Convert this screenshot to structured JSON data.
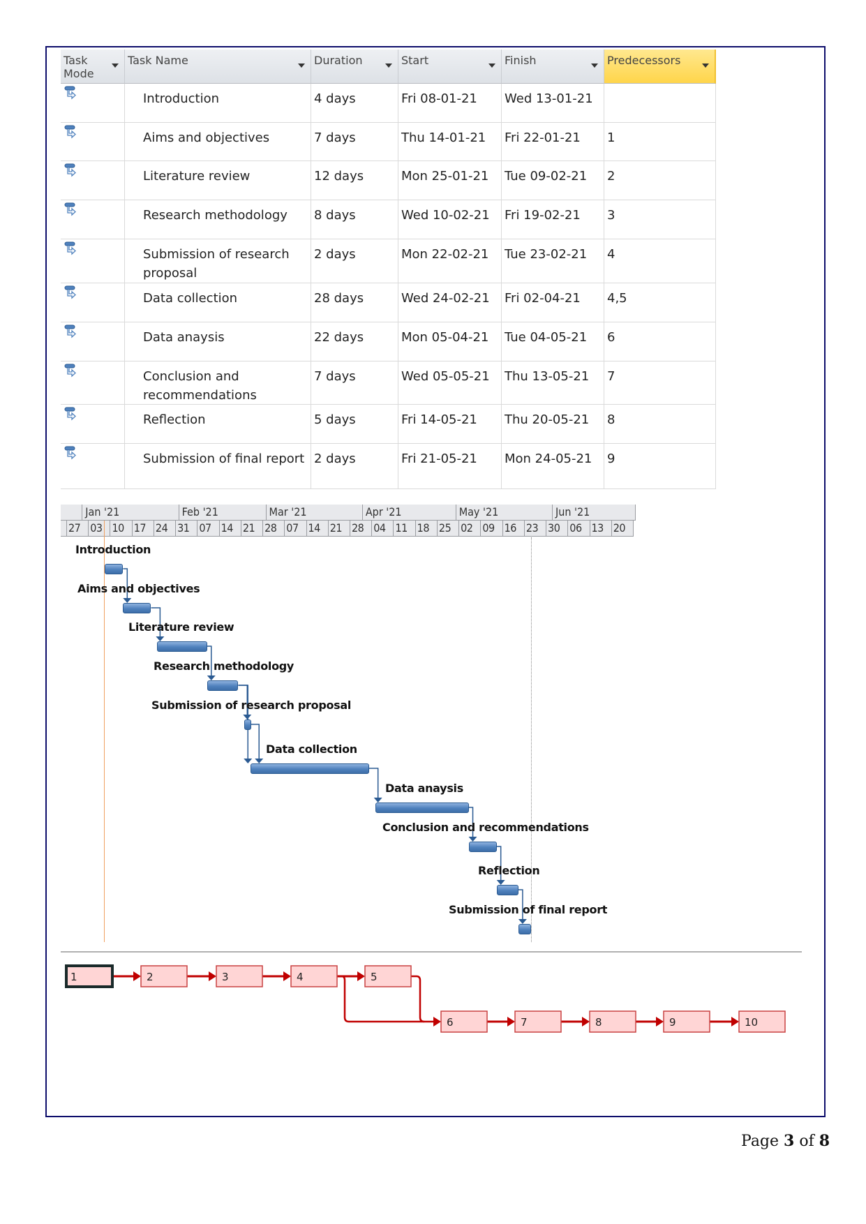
{
  "table": {
    "columns": [
      {
        "label": "Task Mode"
      },
      {
        "label": "Task Name"
      },
      {
        "label": "Duration"
      },
      {
        "label": "Start"
      },
      {
        "label": "Finish"
      },
      {
        "label": "Predecessors"
      }
    ],
    "tasks": [
      {
        "id": 1,
        "mode_icon": "auto-scheduled-task-icon",
        "name": "Introduction",
        "duration": "4 days",
        "start": "Fri 08-01-21",
        "finish": "Wed 13-01-21",
        "predecessors": ""
      },
      {
        "id": 2,
        "mode_icon": "auto-scheduled-task-icon",
        "name": "Aims and objectives",
        "duration": "7 days",
        "start": "Thu 14-01-21",
        "finish": "Fri 22-01-21",
        "predecessors": "1"
      },
      {
        "id": 3,
        "mode_icon": "auto-scheduled-task-icon",
        "name": "Literature review",
        "duration": "12 days",
        "start": "Mon 25-01-21",
        "finish": "Tue 09-02-21",
        "predecessors": "2"
      },
      {
        "id": 4,
        "mode_icon": "auto-scheduled-task-icon",
        "name": "Research methodology",
        "duration": "8 days",
        "start": "Wed 10-02-21",
        "finish": "Fri 19-02-21",
        "predecessors": "3"
      },
      {
        "id": 5,
        "mode_icon": "auto-scheduled-task-icon",
        "name": "Submission of research proposal",
        "duration": "2 days",
        "start": "Mon 22-02-21",
        "finish": "Tue 23-02-21",
        "predecessors": "4"
      },
      {
        "id": 6,
        "mode_icon": "auto-scheduled-task-icon",
        "name": "Data collection",
        "duration": "28 days",
        "start": "Wed 24-02-21",
        "finish": "Fri 02-04-21",
        "predecessors": "4,5"
      },
      {
        "id": 7,
        "mode_icon": "auto-scheduled-task-icon",
        "name": "Data anaysis",
        "duration": "22 days",
        "start": "Mon 05-04-21",
        "finish": "Tue 04-05-21",
        "predecessors": "6"
      },
      {
        "id": 8,
        "mode_icon": "auto-scheduled-task-icon",
        "name": "Conclusion and recommendations",
        "duration": "7 days",
        "start": "Wed 05-05-21",
        "finish": "Thu 13-05-21",
        "predecessors": "7"
      },
      {
        "id": 9,
        "mode_icon": "auto-scheduled-task-icon",
        "name": "Reflection",
        "duration": "5 days",
        "start": "Fri 14-05-21",
        "finish": "Thu 20-05-21",
        "predecessors": "8"
      },
      {
        "id": 10,
        "mode_icon": "auto-scheduled-task-icon",
        "name": "Submission of final report",
        "duration": "2 days",
        "start": "Fri 21-05-21",
        "finish": "Mon 24-05-21",
        "predecessors": "9"
      }
    ]
  },
  "timescale": {
    "months": [
      "",
      "Jan '21",
      "Feb '21",
      "Mar '21",
      "Apr '21",
      "May '21",
      "Jun '21"
    ],
    "weeks": [
      "",
      "27",
      "03",
      "10",
      "17",
      "24",
      "31",
      "07",
      "14",
      "21",
      "28",
      "07",
      "14",
      "21",
      "28",
      "04",
      "11",
      "18",
      "25",
      "02",
      "09",
      "16",
      "23",
      "30",
      "06",
      "13",
      "20"
    ]
  },
  "network": {
    "nodes": [
      "1",
      "2",
      "3",
      "4",
      "5",
      "6",
      "7",
      "8",
      "9",
      "10"
    ],
    "selected": "1"
  },
  "colors": {
    "bar": "#4f81bd",
    "link": "#2a5a92",
    "network_link": "#c00000",
    "network_box": "#ffd5d5",
    "header_highlight": "#ffd54a",
    "frame": "#0d0d6b"
  },
  "footer": {
    "page_word": "Page",
    "current": "3",
    "of_word": "of",
    "total": "8"
  }
}
